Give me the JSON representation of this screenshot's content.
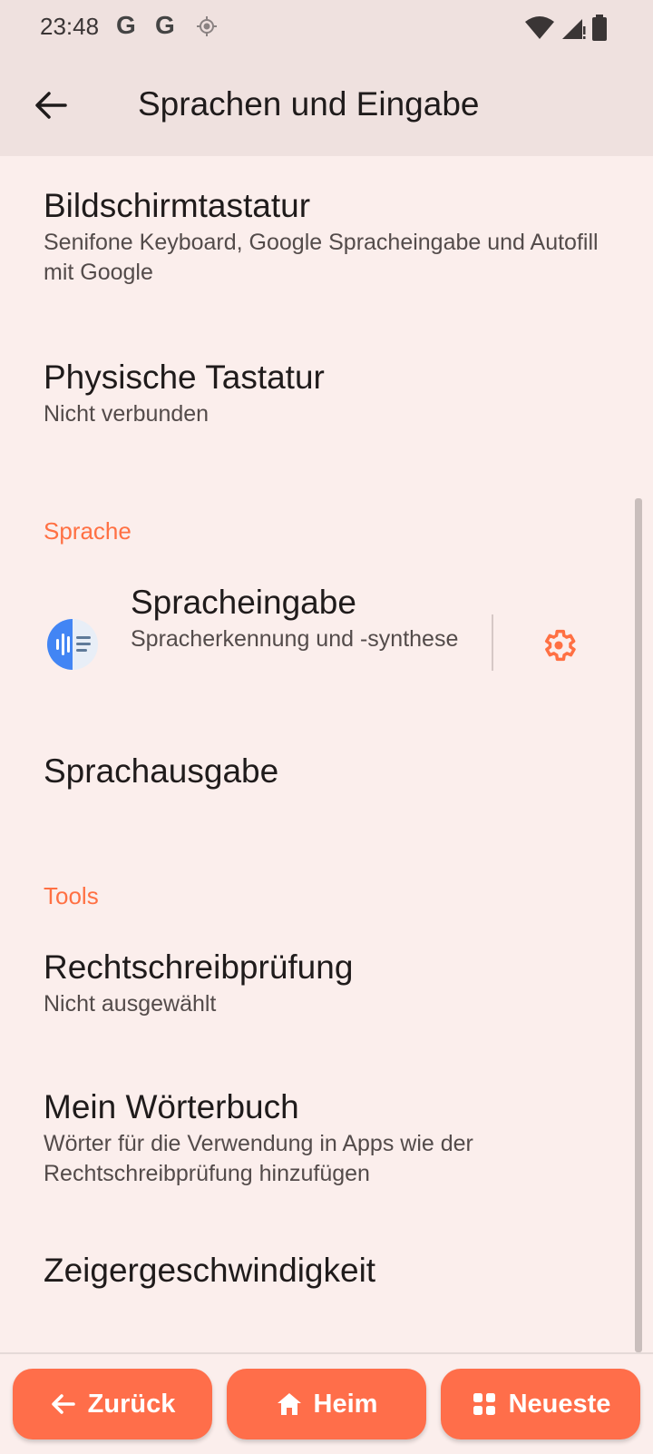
{
  "status_bar": {
    "time": "23:48",
    "g1": "G",
    "g2": "G"
  },
  "app_bar": {
    "title": "Sprachen und Eingabe"
  },
  "items": {
    "onscreen_keyboard": {
      "title": "Bildschirmtastatur",
      "subtitle": "Senifone Keyboard, Google Spracheingabe und Autofill mit Google"
    },
    "physical_keyboard": {
      "title": "Physische Tastatur",
      "subtitle": "Nicht verbunden"
    },
    "voice_input": {
      "title": "Spracheingabe",
      "subtitle": "Spracherkennung und -synthese"
    },
    "tts": {
      "title": "Sprachausgabe"
    },
    "spellcheck": {
      "title": "Rechtschreibprüfung",
      "subtitle": "Nicht ausgewählt"
    },
    "dictionary": {
      "title": "Mein Wörterbuch",
      "subtitle": "Wörter für die Verwendung in Apps wie der Rechtschreibprüfung hinzufügen"
    },
    "pointer_speed": {
      "title": "Zeigergeschwindigkeit"
    }
  },
  "sections": {
    "language": "Sprache",
    "tools": "Tools"
  },
  "bottom_nav": {
    "back": "Zurück",
    "home": "Heim",
    "recent": "Neueste"
  },
  "colors": {
    "accent": "#ff7043",
    "button": "#ff6e4a",
    "background": "#fbeeec"
  }
}
